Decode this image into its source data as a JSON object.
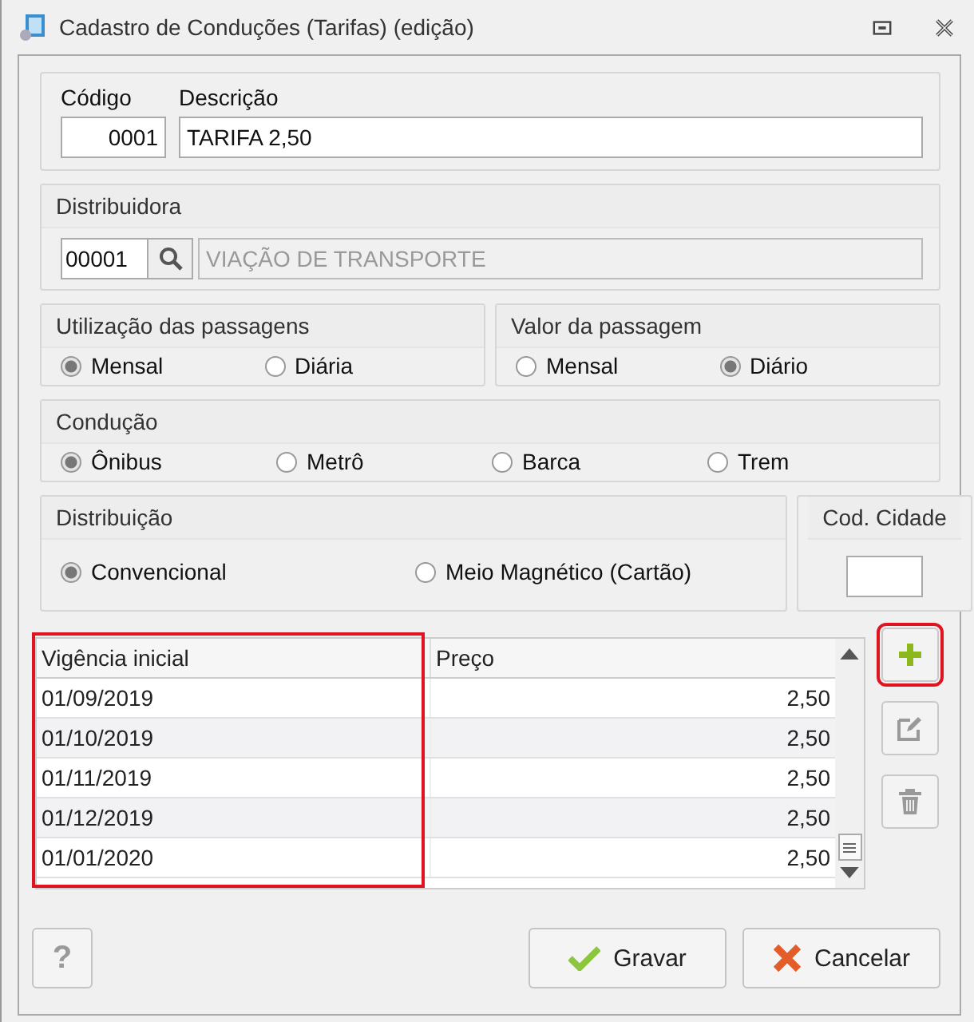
{
  "window": {
    "title": "Cadastro de Conduções (Tarifas) (edição)"
  },
  "code": {
    "label": "Código",
    "value": "0001"
  },
  "description": {
    "label": "Descrição",
    "value": "TARIFA 2,50"
  },
  "distributor": {
    "title": "Distribuidora",
    "code": "00001",
    "name": "VIAÇÃO DE TRANSPORTE"
  },
  "radio_groups": [
    {
      "title": "Utilização das passagens",
      "options": [
        {
          "label": "Mensal",
          "selected": true
        },
        {
          "label": "Diária",
          "selected": false
        }
      ]
    },
    {
      "title": "Valor da passagem",
      "options": [
        {
          "label": "Mensal",
          "selected": false
        },
        {
          "label": "Diário",
          "selected": true
        }
      ]
    },
    {
      "title": "Condução",
      "options": [
        {
          "label": "Ônibus",
          "selected": true
        },
        {
          "label": "Metrô",
          "selected": false
        },
        {
          "label": "Barca",
          "selected": false
        },
        {
          "label": "Trem",
          "selected": false
        }
      ]
    },
    {
      "title": "Distribuição",
      "options": [
        {
          "label": "Convencional",
          "selected": true
        },
        {
          "label": "Meio Magnético (Cartão)",
          "selected": false
        }
      ]
    }
  ],
  "city_code": {
    "title": "Cod. Cidade"
  },
  "table": {
    "columns": [
      {
        "label": "Vigência inicial",
        "highlighted": true
      },
      {
        "label": "Preço",
        "highlighted": false
      }
    ],
    "rows": [
      [
        "01/09/2019",
        "2,50"
      ],
      [
        "01/10/2019",
        "2,50"
      ],
      [
        "01/11/2019",
        "2,50"
      ],
      [
        "01/12/2019",
        "2,50"
      ],
      [
        "01/01/2020",
        "2,50"
      ]
    ]
  },
  "side_buttons": [
    {
      "kind": "add",
      "highlighted": true
    },
    {
      "kind": "edit",
      "highlighted": false
    },
    {
      "kind": "delete",
      "highlighted": false
    }
  ],
  "help_button": "?",
  "buttons": [
    {
      "kind": "save",
      "label": "Gravar"
    },
    {
      "kind": "cancel",
      "label": "Cancelar"
    }
  ]
}
